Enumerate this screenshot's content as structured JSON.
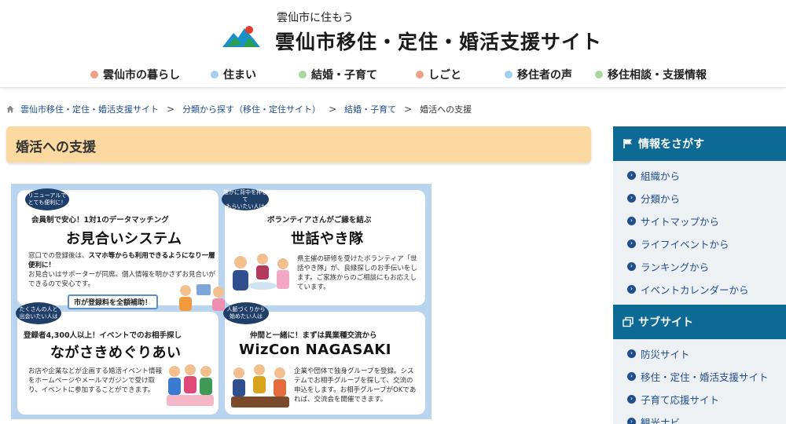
{
  "header": {
    "tagline": "雲仙市に住もう",
    "site_title": "雲仙市移住・定住・婚活支援サイト"
  },
  "gnav": [
    {
      "label": "雲仙市の暮らし",
      "color": "#f0a08a"
    },
    {
      "label": "住まい",
      "color": "#9fd0ee"
    },
    {
      "label": "結婚・子育て",
      "color": "#a8d8a0"
    },
    {
      "label": "しごと",
      "color": "#f0a08a"
    },
    {
      "label": "移住者の声",
      "color": "#9fd0ee"
    },
    {
      "label": "移住相談・支援情報",
      "color": "#a8d8a0"
    }
  ],
  "breadcrumb": {
    "items": [
      "雲仙市移住・定住・婚活支援サイト",
      "分類から探す（移住・定住サイト）",
      "結婚・子育て"
    ],
    "separator": ">",
    "current": "婚活への支援"
  },
  "page_title": "婚活への支援",
  "banner": {
    "card1": {
      "bubble": "リニューアルで\nとても便利に！",
      "sub": "会員制で安心！1対1のデータマッチング",
      "title": "お見合いシステム",
      "body_a": "窓口での登録後は、",
      "body_hl": "スマホ等からも利用できるようになり一層便利に！",
      "body_b": "お見合いはサポーターが同席。個人情報を明かさずお見合いができるので安心です。",
      "badge": "市が登録料を全額補助！"
    },
    "card2": {
      "bubble": "誰かに背中を押して\nもらいたい人は",
      "sub": "ボランティアさんがご縁を結ぶ",
      "title": "世話やき隊",
      "body": "県主催の研修を受けたボランティア「世話やき隊」が、良縁探しのお手伝いをします。ご家族からのご相談にもお応えしています。"
    },
    "card3": {
      "bubble": "たくさんの人と\n出会いたい人は",
      "sub": "登録者4,300人以上！イベントでのお相手探し",
      "title": "ながさきめぐりあい",
      "body": "お店や企業などが企画する婚活イベント情報をホームページやメールマガジンで受け取り、イベントに参加することができます。"
    },
    "card4": {
      "bubble": "人脈づくりから\n始めたい人は",
      "sub": "仲間と一緒に！まずは異業種交流から",
      "title": "WizCon NAGASAKI",
      "body": "企業や団体で独身グループを登録。システムでお相手グループを探して、交流の申込をします。お相手グループがOKであれば、交流会を開催できます。"
    }
  },
  "sidebar": {
    "search_heading": "情報をさがす",
    "search_items": [
      "組織から",
      "分類から",
      "サイトマップから",
      "ライフイベントから",
      "ランキングから",
      "イベントカレンダーから"
    ],
    "sub_heading": "サブサイト",
    "sub_items": [
      "防災サイト",
      "移住・定住・婚活支援サイト",
      "子育て応援サイト",
      "観光ナビ"
    ]
  },
  "colors": {
    "heading_bg": "#fbd9a0",
    "sidebar_head": "#0d6a94",
    "link": "#1f4e8c"
  }
}
